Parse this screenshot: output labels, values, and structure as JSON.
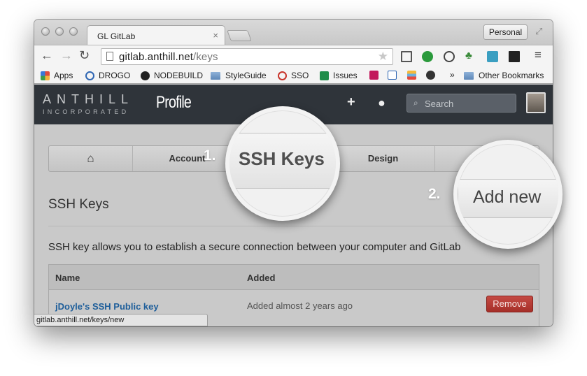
{
  "browser": {
    "tab_title": "GL GitLab",
    "tab_close": "×",
    "profile_button": "Personal",
    "url_host": "gitlab.anthill.net",
    "url_path": "/keys",
    "status_url": "gitlab.anthill.net/keys/new",
    "nav_icons": [
      "back-icon",
      "forward-icon",
      "reload-icon"
    ],
    "bookmarks": [
      "Apps",
      "DROGO",
      "NODEBUILD",
      "StyleGuide",
      "SSO",
      "Issues"
    ],
    "bookmarks_overflow": "»",
    "other_bookmarks": "Other Bookmarks"
  },
  "header": {
    "logo_top": "ANTHILL",
    "logo_bottom": "INCORPORATED",
    "section": "Profile",
    "search_placeholder": "Search"
  },
  "profile_nav": {
    "items": [
      "Account",
      "SSH Keys",
      "Design"
    ]
  },
  "main": {
    "heading": "SSH Keys",
    "description": "SSH key allows you to establish a secure connection between your computer and GitLab",
    "add_button": "Add new",
    "table": {
      "columns": [
        "Name",
        "Added"
      ],
      "rows": [
        {
          "name": "jDoyle's SSH Public key",
          "added": "Added almost 2 years ago",
          "action": "Remove"
        }
      ]
    }
  },
  "callouts": {
    "step1": "1.",
    "step2": "2."
  },
  "colors": {
    "header_bg": "#2f343a",
    "link": "#1e5e9a",
    "remove_button": "#b53a33",
    "dim_content": "#c9c9c9"
  }
}
